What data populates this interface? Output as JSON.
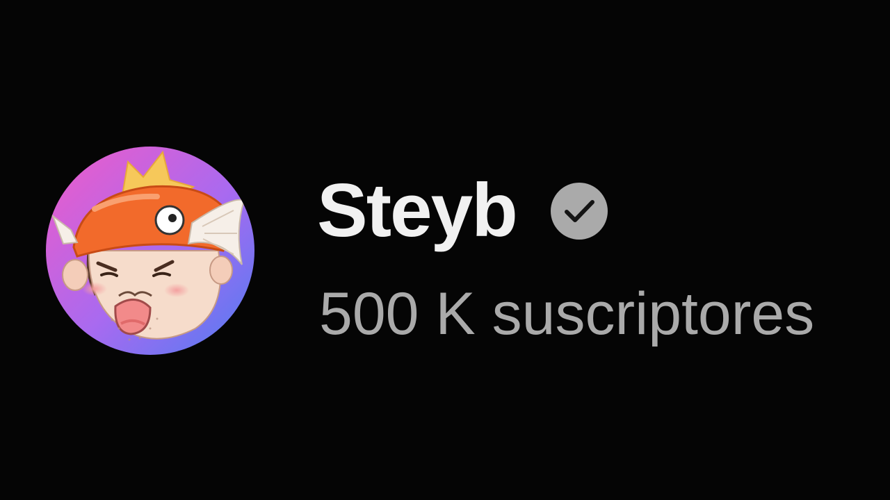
{
  "channel": {
    "name": "Steyb",
    "subscribers": "500 K suscriptores",
    "verified": true,
    "avatar_icon": "magikarp-hat-avatar"
  },
  "colors": {
    "background": "#050505",
    "name_text": "#f1f1f1",
    "subscriber_text": "#aaaaaa",
    "verified_badge": "#aaaaaa"
  }
}
